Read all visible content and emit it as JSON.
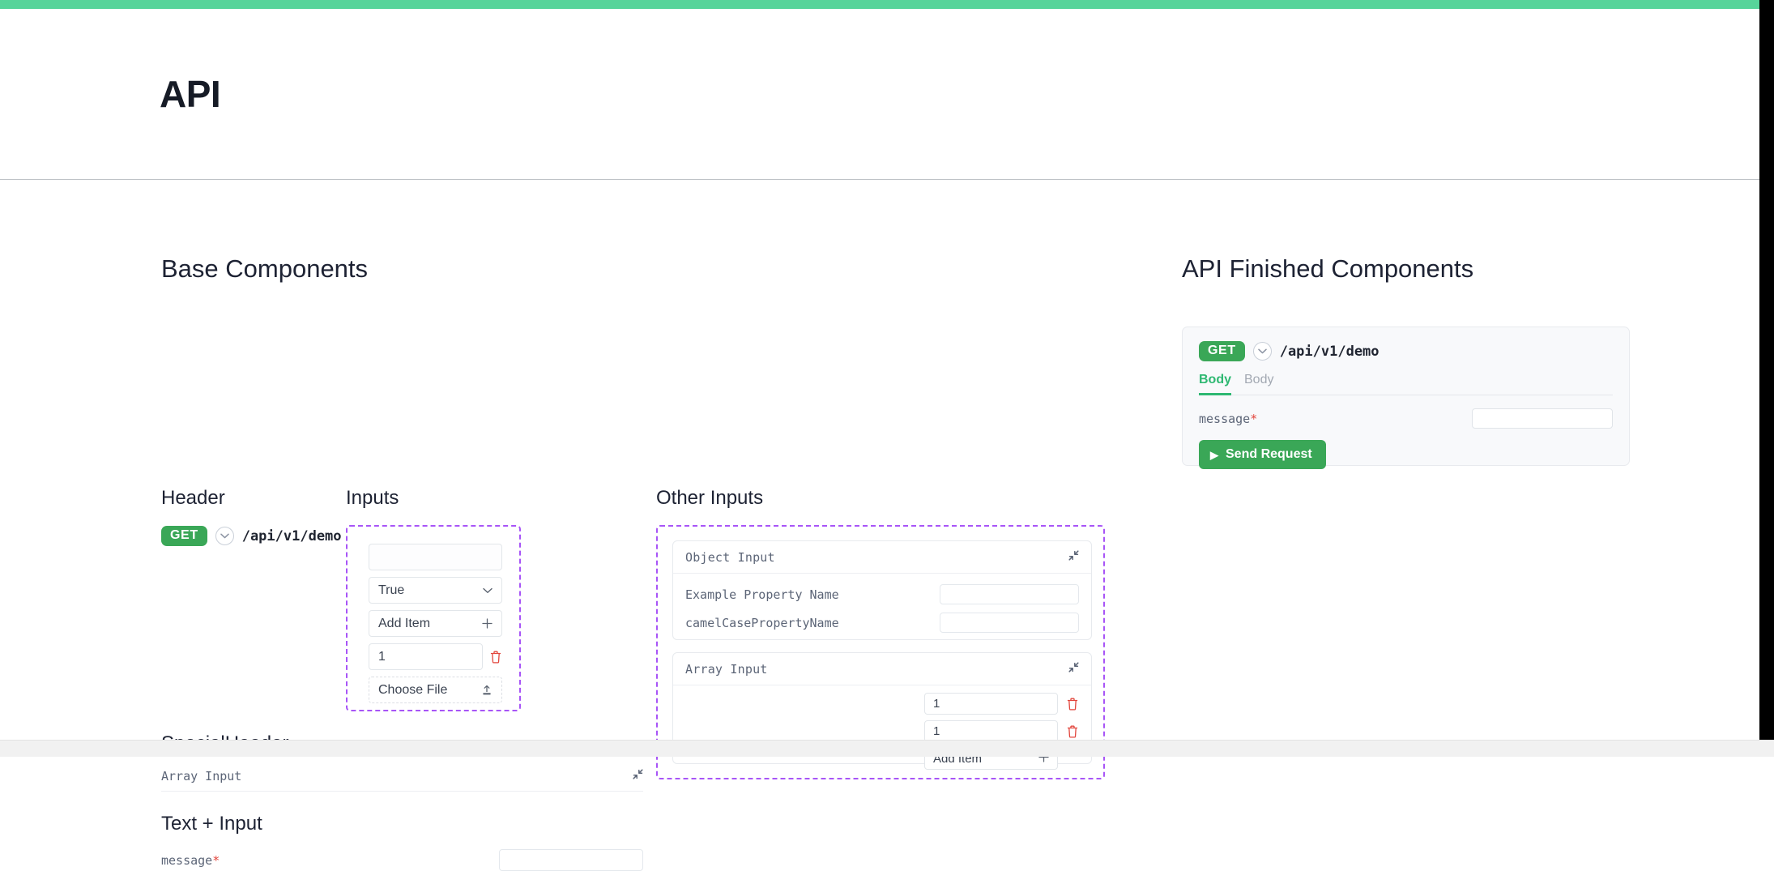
{
  "theme": {
    "accent_green": "#57d49a",
    "method_green": "#3aa757",
    "tab_green": "#2eb872",
    "dashed_purple": "#a855f7",
    "required_red": "#e2453c",
    "trash_red": "#e2453c"
  },
  "header": {
    "title": "API"
  },
  "left_column": {
    "section_title": "Base Components",
    "header_group": {
      "subtitle": "Header",
      "endpoint": {
        "method": "GET",
        "path": "/api/v1/demo",
        "chevron_icon": "chevron-down-icon"
      }
    },
    "inputs_group": {
      "subtitle": "Inputs",
      "controls": [
        {
          "type": "text",
          "value": "",
          "placeholder": ""
        },
        {
          "type": "select",
          "value": "True",
          "icon": "chevron-down-icon"
        },
        {
          "type": "add-item",
          "label": "Add Item",
          "icon": "plus-icon"
        },
        {
          "type": "number-with-delete",
          "value": "1",
          "icon": "trash-icon"
        },
        {
          "type": "file",
          "label": "Choose File",
          "icon": "upload-icon"
        }
      ]
    },
    "special_header_group": {
      "subtitle": "SpecialHeader",
      "array_input_label": "Array Input",
      "collapse_icon": "collapse-diagonal-icon"
    },
    "text_input_group": {
      "subtitle": "Text + Input",
      "field_label": "message",
      "required_marker": "*",
      "value": ""
    }
  },
  "other_inputs": {
    "subtitle": "Other Inputs",
    "object_card": {
      "title": "Object Input",
      "collapse_icon": "collapse-diagonal-icon",
      "properties": [
        {
          "label": "Example Property Name",
          "value": ""
        },
        {
          "label": "camelCasePropertyName",
          "value": ""
        }
      ]
    },
    "array_card": {
      "title": "Array Input",
      "collapse_icon": "collapse-diagonal-icon",
      "items": [
        {
          "value": "1",
          "delete_icon": "trash-icon"
        },
        {
          "value": "1",
          "delete_icon": "trash-icon"
        }
      ],
      "add_label": "Add Item",
      "add_icon": "plus-icon"
    }
  },
  "right_column": {
    "section_title": "API Finished Components",
    "card": {
      "method": "GET",
      "path": "/api/v1/demo",
      "chevron_icon": "chevron-down-icon",
      "tabs": [
        {
          "label": "Body",
          "active": true
        },
        {
          "label": "Body",
          "active": false
        }
      ],
      "field_label": "message",
      "required_marker": "*",
      "field_value": "",
      "send_button": {
        "label": "Send Request",
        "icon": "play-icon"
      }
    }
  }
}
